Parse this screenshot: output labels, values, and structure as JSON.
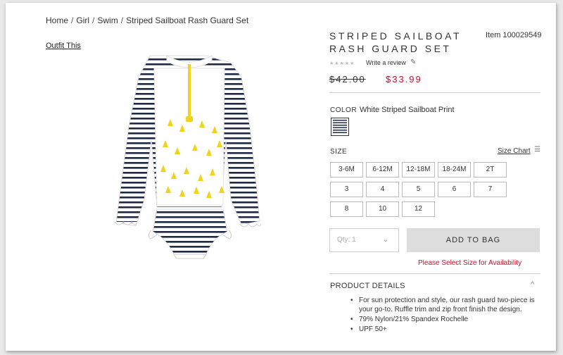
{
  "breadcrumb": [
    "Home",
    "Girl",
    "Swim",
    "Striped Sailboat Rash Guard Set"
  ],
  "breadcrumb_sep": "/",
  "outfit_link": "Outfit This",
  "product": {
    "title": "STRIPED SAILBOAT RASH GUARD SET",
    "item_number": "Item 100029549",
    "rating_stars": "★★★★★",
    "write_review": "Write a review",
    "pencil_icon": "✎",
    "price_original": "$42.00",
    "price_sale": "$33.99"
  },
  "color": {
    "label": "COLOR",
    "name": "White Striped Sailboat Print"
  },
  "size": {
    "label": "SIZE",
    "chart_link": "Size Chart",
    "ruler_icon": "📏",
    "options": [
      "3-6M",
      "6-12M",
      "12-18M",
      "18-24M",
      "2T",
      "3",
      "4",
      "5",
      "6",
      "7",
      "8",
      "10",
      "12"
    ]
  },
  "purchase": {
    "qty_placeholder": "Qty: 1",
    "qty_chevron": "⌄",
    "add_to_bag": "ADD TO BAG",
    "availability_message": "Please Select Size for Availability"
  },
  "details": {
    "title": "PRODUCT DETAILS",
    "chevron": "^",
    "bullets": [
      "For sun protection and style, our rash guard two-piece is your go-to. Ruffle trim and zip front finish the design.",
      "79% Nylon/21% Spandex Rochelle",
      "UPF 50+"
    ]
  },
  "colors": {
    "sale": "#c8102e",
    "stripe": "#1f2a44",
    "zip": "#f2d21a",
    "button_bg": "#dddddd"
  }
}
